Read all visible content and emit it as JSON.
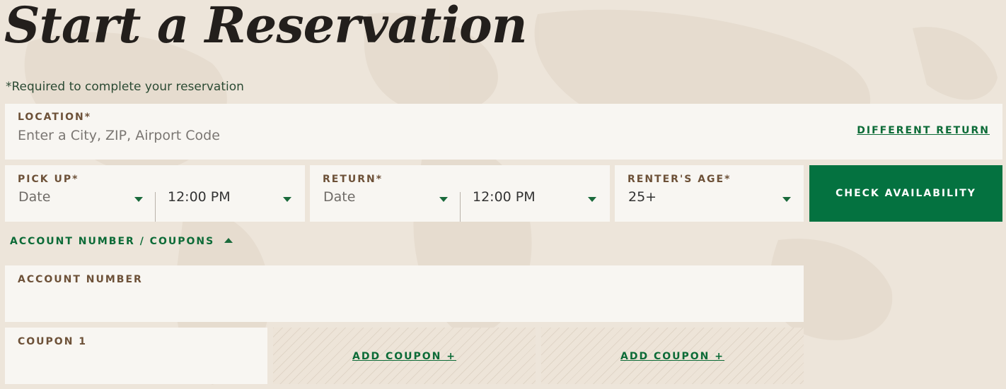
{
  "page": {
    "title": "Start a Reservation",
    "required_note": "*Required to complete your reservation"
  },
  "location": {
    "label": "LOCATION*",
    "placeholder": "Enter a City, ZIP, Airport Code",
    "different_return": "DIFFERENT RETURN"
  },
  "pickup": {
    "label": "PICK UP*",
    "date": "Date",
    "time": "12:00 PM"
  },
  "return": {
    "label": "RETURN*",
    "date": "Date",
    "time": "12:00 PM"
  },
  "renter_age": {
    "label": "RENTER'S AGE*",
    "value": "25+"
  },
  "check_availability": "CHECK AVAILABILITY",
  "account_toggle": "ACCOUNT NUMBER / COUPONS",
  "account_number": {
    "label": "ACCOUNT NUMBER"
  },
  "coupons": {
    "coupon1_label": "COUPON 1",
    "add_coupon_2": "ADD COUPON +",
    "add_coupon_3": "ADD COUPON +"
  },
  "colors": {
    "accent_green": "#047240",
    "label_brown": "#6d5138",
    "background": "#ede5da"
  }
}
